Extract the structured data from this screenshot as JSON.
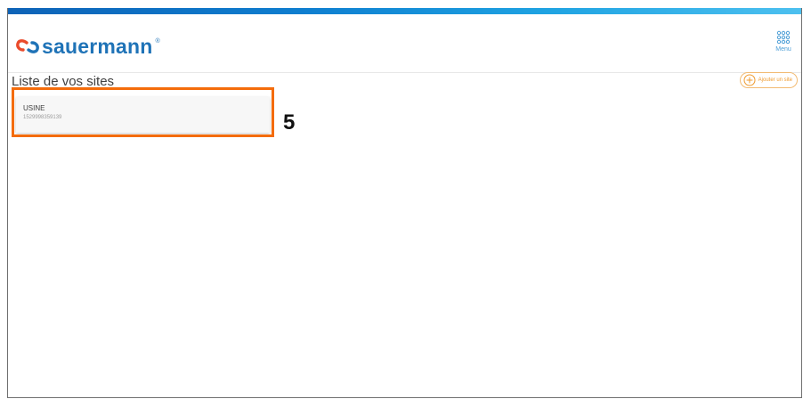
{
  "brand": {
    "name": "sauermann",
    "trademark": "®"
  },
  "menu": {
    "label": "Menu",
    "icon": "grid-menu-icon"
  },
  "page": {
    "title": "Liste de vos sites"
  },
  "actions": {
    "add_site_label": "Ajouter un site",
    "add_site_icon": "plus-circle-icon"
  },
  "sites": [
    {
      "name": "USINE",
      "id": "1529998359139"
    }
  ],
  "annotation": {
    "number": "5"
  },
  "colors": {
    "brand_blue": "#1f73b7",
    "accent_orange": "#ef9b2f",
    "highlight_orange": "#f46c0b"
  }
}
